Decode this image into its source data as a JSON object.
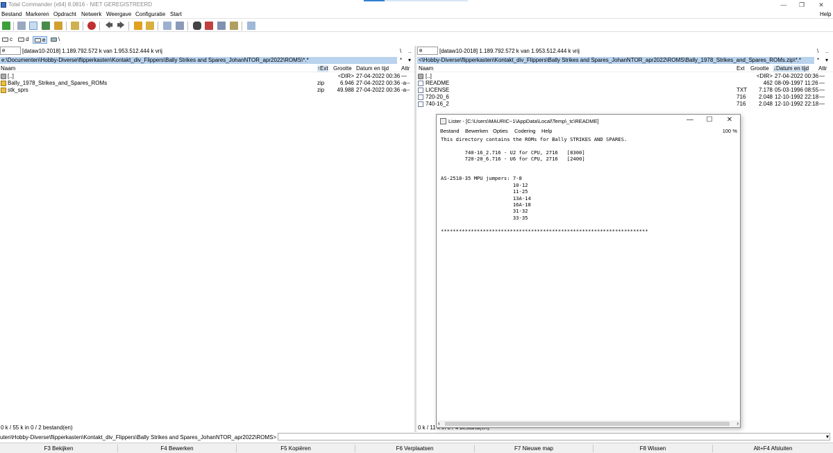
{
  "window": {
    "title": "Total Commander (x64) 8.0816 - NIET GEREGISTREERD",
    "help_menu": "Help"
  },
  "menubar": {
    "items": [
      "Bestand",
      "Markeren",
      "Opdracht",
      "Netwerk",
      "Weergave",
      "Configuratie",
      "Start"
    ]
  },
  "drivebar": {
    "drives": [
      "c",
      "d",
      "e",
      "\\"
    ]
  },
  "left_panel": {
    "drive": "e",
    "drive_info": "[dataw10-2018]  1.189.792.572 k  van  1.953.512.444 k vrij",
    "path": "e:\\Documenten\\Hobby-Diverse\\flipperkasten\\Kontakt_div_Flippers\\Bally Strikes and Spares_JohanNTOR_apr2022\\ROMS\\*.*",
    "filter": "*",
    "columns": {
      "name": "Naam",
      "ext": "↑Ext",
      "size": "Grootte",
      "date": "Datum en tijd",
      "attr": "Attr"
    },
    "rows": [
      {
        "icon": "up-dir-icon",
        "name": "[..]",
        "ext": "",
        "size": "<DIR>",
        "date": "27-04-2022 00:36",
        "attr": "—"
      },
      {
        "icon": "zip-icon",
        "name": "Bally_1978_Strikes_and_Spares_ROMs",
        "ext": "zip",
        "size": "6.946",
        "date": "27-04-2022 00:36",
        "attr": "-a--"
      },
      {
        "icon": "zip-icon",
        "name": "stk_sprs",
        "ext": "zip",
        "size": "49.988",
        "date": "27-04-2022 00:36",
        "attr": "-a--"
      }
    ],
    "status": "0 k / 55 k in 0 / 2 bestand(en)"
  },
  "right_panel": {
    "drive": "e",
    "drive_info": "[dataw10-2018]  1.189.792.572 k  van  1.953.512.444 k vrij",
    "path": "<\\Hobby-Diverse\\flipperkasten\\Kontakt_div_Flippers\\Bally Strikes and Spares_JohanNTOR_apr2022\\ROMS\\Bally_1978_Strikes_and_Spares_ROMs.zip\\*.*",
    "filter": "*",
    "columns": {
      "name": "Naam",
      "ext": "Ext",
      "size": "Grootte",
      "date": "↓Datum en tijd",
      "attr": "Attr"
    },
    "rows": [
      {
        "icon": "up-dir-icon",
        "name": "[..]",
        "ext": "",
        "size": "<DIR>",
        "date": "27-04-2022 00:36",
        "attr": "—"
      },
      {
        "icon": "document-icon",
        "name": "README",
        "ext": "",
        "size": "462",
        "date": "08-09-1997 11:26",
        "attr": "—"
      },
      {
        "icon": "document-icon",
        "name": "LICENSE",
        "ext": "TXT",
        "size": "7.178",
        "date": "05-03-1996 08:55",
        "attr": "—"
      },
      {
        "icon": "document-icon",
        "name": "720-20_6",
        "ext": "716",
        "size": "2.048",
        "date": "12-10-1992 22:18",
        "attr": "—"
      },
      {
        "icon": "document-icon",
        "name": "740-16_2",
        "ext": "716",
        "size": "2.048",
        "date": "12-10-1992 22:18",
        "attr": "—"
      }
    ],
    "status": "0 k / 11 k in 0 / 4 bestand(en)"
  },
  "cmdline": {
    "prompt": "uten\\Hobby-Diverse\\flipperkasten\\Kontakt_div_Flippers\\Bally Strikes and Spares_JohanNTOR_apr2022\\ROMS>"
  },
  "fkeys": [
    "F3 Bekijken",
    "F4 Bewerken",
    "F5 Kopiëren",
    "F6 Verplaatsen",
    "F7 Nieuwe map",
    "F8 Wissen",
    "Alt+F4 Afsluiten"
  ],
  "lister": {
    "title": "Lister - [C:\\Users\\MAURIC~1\\AppData\\Local\\Temp\\_tc\\README]",
    "menu": [
      "Bestand",
      "Bewerken",
      "Opties",
      "Codering",
      "Help"
    ],
    "zoom": "100 %",
    "content": "This directory contains the ROMs for Bally STRIKES AND SPARES.\n\n        740-16_2.716 - U2 for CPU, 2716   [8300]\n        720-20_6.716 - U6 for CPU, 2716   [2400]\n\n\nAS-2518-35 MPU jumpers: 7-8\n                        10-12\n                        11-25\n                        13A-14\n                        16A-18\n                        31-32\n                        33-35\n\n*********************************************************************"
  },
  "colors": {
    "path_highlight": "#b9d3ee",
    "title_text": "#888888"
  }
}
